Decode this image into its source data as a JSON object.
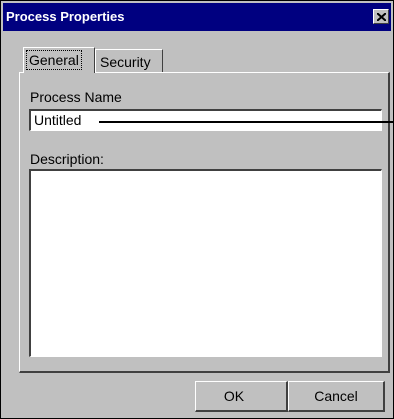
{
  "window": {
    "title": "Process Properties"
  },
  "tabs": [
    {
      "label": "General",
      "selected": true
    },
    {
      "label": "Security",
      "selected": false
    }
  ],
  "general": {
    "process_name_label": "Process Name",
    "process_name_value": "Untitled",
    "description_label": "Description:",
    "description_value": ""
  },
  "buttons": {
    "ok_label": "OK",
    "cancel_label": "Cancel"
  },
  "colors": {
    "titlebar": "#000080",
    "face": "#c0c0c0"
  },
  "icons": {
    "close": "close-icon"
  }
}
